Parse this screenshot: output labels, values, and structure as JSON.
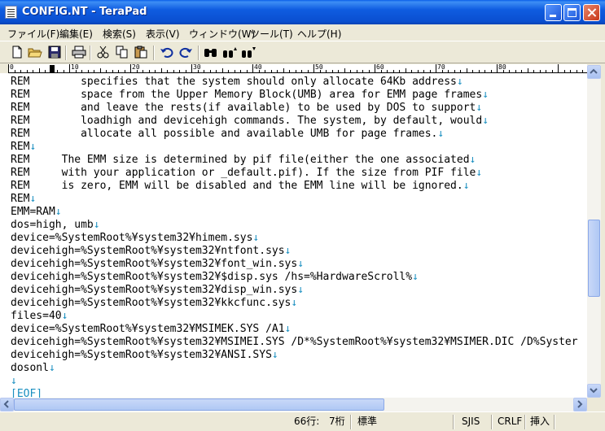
{
  "window": {
    "title": "CONFIG.NT - TeraPad"
  },
  "menu": [
    {
      "label": "ファイル(F)"
    },
    {
      "label": "編集(E)"
    },
    {
      "label": "検索(S)"
    },
    {
      "label": "表示(V)"
    },
    {
      "label": "ウィンドウ(W)"
    },
    {
      "label": "ツール(T)"
    },
    {
      "label": "ヘルプ(H)"
    }
  ],
  "toolbar": {
    "icons": [
      "new-file-icon",
      "open-folder-icon",
      "save-icon",
      "print-icon",
      "cut-icon",
      "copy-icon",
      "paste-icon",
      "undo-icon",
      "redo-icon",
      "find-icon",
      "find-up-icon",
      "find-down-icon"
    ]
  },
  "ruler": {
    "labels": [
      "0",
      "10",
      "20",
      "30",
      "40",
      "50",
      "60",
      "70",
      "80"
    ]
  },
  "editor": {
    "eol_mark": "↓",
    "lines": [
      {
        "text": "REM        specifies that the system should only allocate 64Kb address",
        "eol": true
      },
      {
        "text": "REM        space from the Upper Memory Block(UMB) area for EMM page frames",
        "eol": true
      },
      {
        "text": "REM        and leave the rests(if available) to be used by DOS to support",
        "eol": true
      },
      {
        "text": "REM        loadhigh and devicehigh commands. The system, by default, would",
        "eol": true
      },
      {
        "text": "REM        allocate all possible and available UMB for page frames.",
        "eol": true
      },
      {
        "text": "REM",
        "eol": true
      },
      {
        "text": "REM     The EMM size is determined by pif file(either the one associated",
        "eol": true
      },
      {
        "text": "REM     with your application or _default.pif). If the size from PIF file",
        "eol": true
      },
      {
        "text": "REM     is zero, EMM will be disabled and the EMM line will be ignored.",
        "eol": true
      },
      {
        "text": "REM",
        "eol": true
      },
      {
        "text": "EMM=RAM",
        "eol": true
      },
      {
        "text": "dos=high, umb",
        "eol": true
      },
      {
        "text": "device=%SystemRoot%¥system32¥himem.sys",
        "eol": true
      },
      {
        "text": "devicehigh=%SystemRoot%¥system32¥ntfont.sys",
        "eol": true
      },
      {
        "text": "devicehigh=%SystemRoot%¥system32¥font_win.sys",
        "eol": true
      },
      {
        "text": "devicehigh=%SystemRoot%¥system32¥$disp.sys /hs=%HardwareScroll%",
        "eol": true
      },
      {
        "text": "devicehigh=%SystemRoot%¥system32¥disp_win.sys",
        "eol": true
      },
      {
        "text": "devicehigh=%SystemRoot%¥system32¥kkcfunc.sys",
        "eol": true
      },
      {
        "text": "files=40",
        "eol": true
      },
      {
        "text": "device=%SystemRoot%¥system32¥MSIMEK.SYS /A1",
        "eol": true
      },
      {
        "text": "devicehigh=%SystemRoot%¥system32¥MSIMEI.SYS /D*%SystemRoot%¥system32¥MSIMER.DIC /D%Syster",
        "eol": false
      },
      {
        "text": "devicehigh=%SystemRoot%¥system32¥ANSI.SYS",
        "eol": true
      },
      {
        "text": "dosonl",
        "eol": true
      },
      {
        "text": "",
        "eol": true
      },
      {
        "text": "[EOF]",
        "eol": false
      }
    ]
  },
  "status": {
    "line": "66行:",
    "column": "7桁",
    "mode": "標準",
    "encoding": "SJIS",
    "newline": "CRLF",
    "insert": "挿入"
  },
  "colors": {
    "eol": "#1a8fc0",
    "titlebar": "#0a5fe8"
  }
}
